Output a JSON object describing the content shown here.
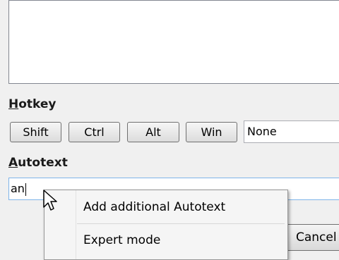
{
  "hotkey": {
    "heading_first": "H",
    "heading_rest": "otkey",
    "buttons": [
      "Shift",
      "Ctrl",
      "Alt",
      "Win"
    ],
    "value": "None"
  },
  "autotext": {
    "heading_first": "A",
    "heading_rest": "utotext",
    "value": "an"
  },
  "context_menu": {
    "items": [
      "Add additional Autotext",
      "Expert mode"
    ]
  },
  "footer": {
    "cancel_label": "Cancel"
  }
}
